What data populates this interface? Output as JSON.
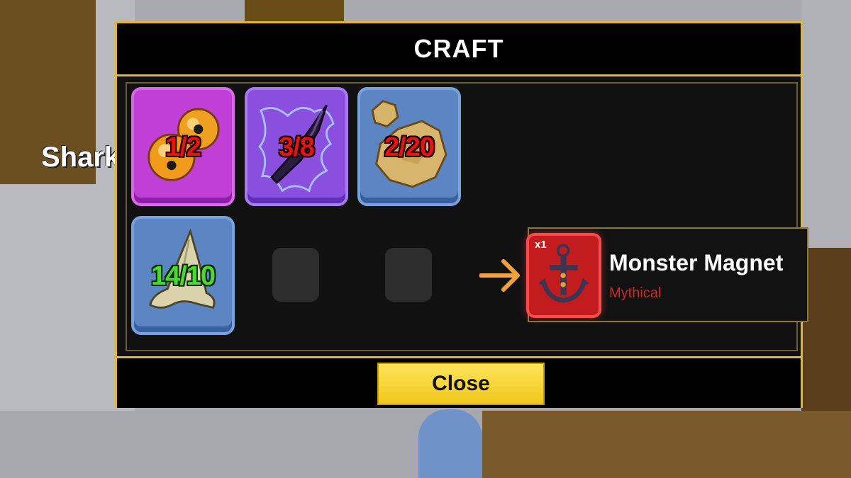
{
  "background": {
    "npc_name": "Shark"
  },
  "craft": {
    "title": "CRAFT",
    "ingredients": [
      {
        "item_icon": "orb-icon",
        "count": "1/2",
        "status": "insufficient",
        "rarity_color": "#c03fd6"
      },
      {
        "item_icon": "dark-blade-icon",
        "count": "3/8",
        "status": "insufficient",
        "rarity_color": "#8b4fe0"
      },
      {
        "item_icon": "ore-icon",
        "count": "2/20",
        "status": "insufficient",
        "rarity_color": "#5c86c3"
      },
      {
        "item_icon": "shark-tooth-icon",
        "count": "14/10",
        "status": "sufficient",
        "rarity_color": "#5c86c3"
      }
    ],
    "result": {
      "quantity": "x1",
      "name": "Monster Magnet",
      "rarity": "Mythical",
      "item_icon": "anchor-icon"
    },
    "close_label": "Close"
  },
  "colors": {
    "accent_gold": "#e4b534",
    "count_insufficient": "#e31414",
    "count_sufficient": "#4bd832",
    "mythical_red": "#c92a2a",
    "arrow_orange": "#f2a23a"
  }
}
